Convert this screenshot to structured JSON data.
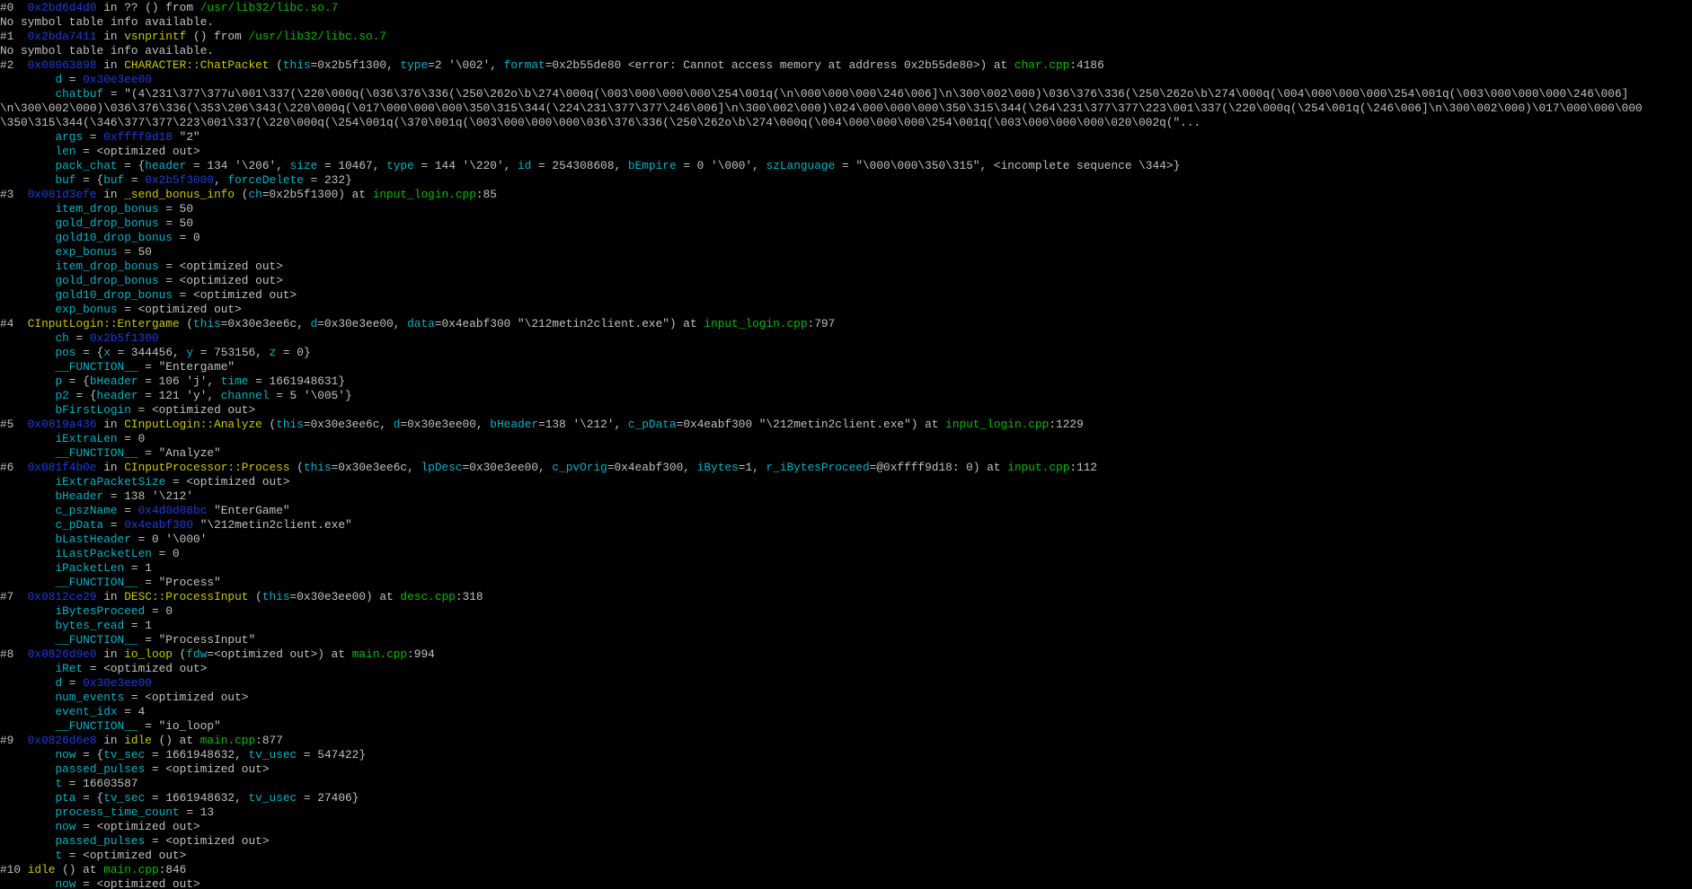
{
  "terminal": {
    "background_color": "#000000",
    "colors": {
      "text": "#c0c0c0",
      "address": "#1a3ce0",
      "function": "#c8c800",
      "variable": "#00b4c8",
      "file": "#00c000"
    },
    "lines": [
      [
        [
          "t",
          "#0  "
        ],
        [
          "addr",
          "0x2bd6d4d0"
        ],
        [
          "t",
          " in ?? () from "
        ],
        [
          "file",
          "/usr/lib32/libc.so.7"
        ]
      ],
      [
        [
          "t",
          "No symbol table info available."
        ]
      ],
      [
        [
          "t",
          "#1  "
        ],
        [
          "addr",
          "0x2bda7411"
        ],
        [
          "t",
          " in "
        ],
        [
          "fn",
          "vsnprintf"
        ],
        [
          "t",
          " () from "
        ],
        [
          "file",
          "/usr/lib32/libc.so.7"
        ]
      ],
      [
        [
          "t",
          "No symbol table info available."
        ]
      ],
      [
        [
          "t",
          "#2  "
        ],
        [
          "addr",
          "0x08063898"
        ],
        [
          "t",
          " in "
        ],
        [
          "fn",
          "CHARACTER::ChatPacket"
        ],
        [
          "t",
          " ("
        ],
        [
          "var",
          "this"
        ],
        [
          "t",
          "=0x2b5f1300, "
        ],
        [
          "var",
          "type"
        ],
        [
          "t",
          "=2 '\\002', "
        ],
        [
          "var",
          "format"
        ],
        [
          "t",
          "=0x2b55de80 <error: Cannot access memory at address 0x2b55de80>) at "
        ],
        [
          "file",
          "char.cpp"
        ],
        [
          "t",
          ":4186"
        ]
      ],
      [
        [
          "t",
          "        "
        ],
        [
          "var",
          "d"
        ],
        [
          "t",
          " = "
        ],
        [
          "addr",
          "0x30e3ee00"
        ]
      ],
      [
        [
          "t",
          "        "
        ],
        [
          "var",
          "chatbuf"
        ],
        [
          "t",
          " = \"(4\\231\\377\\377u\\001\\337(\\220\\000q(\\036\\376\\336(\\250\\262o\\b\\274\\000q(\\003\\000\\000\\000\\254\\001q(\\n\\000\\000\\000\\246\\006]\\n\\300\\002\\000)\\036\\376\\336(\\250\\262o\\b\\274\\000q(\\004\\000\\000\\000\\254\\001q(\\003\\000\\000\\000\\246\\006]"
        ]
      ],
      [
        [
          "t",
          "\\n\\300\\002\\000)\\036\\376\\336(\\353\\206\\343(\\220\\000q(\\017\\000\\000\\000\\350\\315\\344(\\224\\231\\377\\377\\246\\006]\\n\\300\\002\\000)\\024\\000\\000\\000\\350\\315\\344(\\264\\231\\377\\377\\223\\001\\337(\\220\\000q(\\254\\001q(\\246\\006]\\n\\300\\002\\000)\\017\\000\\000\\000"
        ]
      ],
      [
        [
          "t",
          "\\350\\315\\344(\\346\\377\\377\\223\\001\\337(\\220\\000q(\\254\\001q(\\370\\001q(\\003\\000\\000\\000\\036\\376\\336(\\250\\262o\\b\\274\\000q(\\004\\000\\000\\000\\254\\001q(\\003\\000\\000\\000\\020\\002q(\"..."
        ]
      ],
      [
        [
          "t",
          "        "
        ],
        [
          "var",
          "args"
        ],
        [
          "t",
          " = "
        ],
        [
          "addr",
          "0xffff9d18"
        ],
        [
          "t",
          " \"2\""
        ]
      ],
      [
        [
          "t",
          "        "
        ],
        [
          "var",
          "len"
        ],
        [
          "t",
          " = <optimized out>"
        ]
      ],
      [
        [
          "t",
          "        "
        ],
        [
          "var",
          "pack_chat"
        ],
        [
          "t",
          " = {"
        ],
        [
          "var",
          "header"
        ],
        [
          "t",
          " = 134 '\\206', "
        ],
        [
          "var",
          "size"
        ],
        [
          "t",
          " = 10467, "
        ],
        [
          "var",
          "type"
        ],
        [
          "t",
          " = 144 '\\220', "
        ],
        [
          "var",
          "id"
        ],
        [
          "t",
          " = 254308608, "
        ],
        [
          "var",
          "bEmpire"
        ],
        [
          "t",
          " = 0 '\\000', "
        ],
        [
          "var",
          "szLanguage"
        ],
        [
          "t",
          " = \"\\000\\000\\350\\315\", <incomplete sequence \\344>}"
        ]
      ],
      [
        [
          "t",
          "        "
        ],
        [
          "var",
          "buf"
        ],
        [
          "t",
          " = {"
        ],
        [
          "var",
          "buf"
        ],
        [
          "t",
          " = "
        ],
        [
          "addr",
          "0x2b5f3000"
        ],
        [
          "t",
          ", "
        ],
        [
          "var",
          "forceDelete"
        ],
        [
          "t",
          " = 232}"
        ]
      ],
      [
        [
          "t",
          "#3  "
        ],
        [
          "addr",
          "0x081d3efe"
        ],
        [
          "t",
          " in "
        ],
        [
          "fn",
          "_send_bonus_info"
        ],
        [
          "t",
          " ("
        ],
        [
          "var",
          "ch"
        ],
        [
          "t",
          "=0x2b5f1300) at "
        ],
        [
          "file",
          "input_login.cpp"
        ],
        [
          "t",
          ":85"
        ]
      ],
      [
        [
          "t",
          "        "
        ],
        [
          "var",
          "item_drop_bonus"
        ],
        [
          "t",
          " = 50"
        ]
      ],
      [
        [
          "t",
          "        "
        ],
        [
          "var",
          "gold_drop_bonus"
        ],
        [
          "t",
          " = 50"
        ]
      ],
      [
        [
          "t",
          "        "
        ],
        [
          "var",
          "gold10_drop_bonus"
        ],
        [
          "t",
          " = 0"
        ]
      ],
      [
        [
          "t",
          "        "
        ],
        [
          "var",
          "exp_bonus"
        ],
        [
          "t",
          " = 50"
        ]
      ],
      [
        [
          "t",
          "        "
        ],
        [
          "var",
          "item_drop_bonus"
        ],
        [
          "t",
          " = <optimized out>"
        ]
      ],
      [
        [
          "t",
          "        "
        ],
        [
          "var",
          "gold_drop_bonus"
        ],
        [
          "t",
          " = <optimized out>"
        ]
      ],
      [
        [
          "t",
          "        "
        ],
        [
          "var",
          "gold10_drop_bonus"
        ],
        [
          "t",
          " = <optimized out>"
        ]
      ],
      [
        [
          "t",
          "        "
        ],
        [
          "var",
          "exp_bonus"
        ],
        [
          "t",
          " = <optimized out>"
        ]
      ],
      [
        [
          "t",
          "#4  "
        ],
        [
          "fn",
          "CInputLogin::Entergame"
        ],
        [
          "t",
          " ("
        ],
        [
          "var",
          "this"
        ],
        [
          "t",
          "=0x30e3ee6c, "
        ],
        [
          "var",
          "d"
        ],
        [
          "t",
          "=0x30e3ee00, "
        ],
        [
          "var",
          "data"
        ],
        [
          "t",
          "=0x4eabf300 \"\\212metin2client.exe\") at "
        ],
        [
          "file",
          "input_login.cpp"
        ],
        [
          "t",
          ":797"
        ]
      ],
      [
        [
          "t",
          "        "
        ],
        [
          "var",
          "ch"
        ],
        [
          "t",
          " = "
        ],
        [
          "addr",
          "0x2b5f1300"
        ]
      ],
      [
        [
          "t",
          "        "
        ],
        [
          "var",
          "pos"
        ],
        [
          "t",
          " = {"
        ],
        [
          "var",
          "x"
        ],
        [
          "t",
          " = 344456, "
        ],
        [
          "var",
          "y"
        ],
        [
          "t",
          " = 753156, "
        ],
        [
          "var",
          "z"
        ],
        [
          "t",
          " = 0}"
        ]
      ],
      [
        [
          "t",
          "        "
        ],
        [
          "var",
          "__FUNCTION__"
        ],
        [
          "t",
          " = \"Entergame\""
        ]
      ],
      [
        [
          "t",
          "        "
        ],
        [
          "var",
          "p"
        ],
        [
          "t",
          " = {"
        ],
        [
          "var",
          "bHeader"
        ],
        [
          "t",
          " = 106 'j', "
        ],
        [
          "var",
          "time"
        ],
        [
          "t",
          " = 1661948631}"
        ]
      ],
      [
        [
          "t",
          "        "
        ],
        [
          "var",
          "p2"
        ],
        [
          "t",
          " = {"
        ],
        [
          "var",
          "header"
        ],
        [
          "t",
          " = 121 'y', "
        ],
        [
          "var",
          "channel"
        ],
        [
          "t",
          " = 5 '\\005'}"
        ]
      ],
      [
        [
          "t",
          "        "
        ],
        [
          "var",
          "bFirstLogin"
        ],
        [
          "t",
          " = <optimized out>"
        ]
      ],
      [
        [
          "t",
          "#5  "
        ],
        [
          "addr",
          "0x0819a436"
        ],
        [
          "t",
          " in "
        ],
        [
          "fn",
          "CInputLogin::Analyze"
        ],
        [
          "t",
          " ("
        ],
        [
          "var",
          "this"
        ],
        [
          "t",
          "=0x30e3ee6c, "
        ],
        [
          "var",
          "d"
        ],
        [
          "t",
          "=0x30e3ee00, "
        ],
        [
          "var",
          "bHeader"
        ],
        [
          "t",
          "=138 '\\212', "
        ],
        [
          "var",
          "c_pData"
        ],
        [
          "t",
          "=0x4eabf300 \"\\212metin2client.exe\") at "
        ],
        [
          "file",
          "input_login.cpp"
        ],
        [
          "t",
          ":1229"
        ]
      ],
      [
        [
          "t",
          "        "
        ],
        [
          "var",
          "iExtraLen"
        ],
        [
          "t",
          " = 0"
        ]
      ],
      [
        [
          "t",
          "        "
        ],
        [
          "var",
          "__FUNCTION__"
        ],
        [
          "t",
          " = \"Analyze\""
        ]
      ],
      [
        [
          "t",
          "#6  "
        ],
        [
          "addr",
          "0x081f4b0e"
        ],
        [
          "t",
          " in "
        ],
        [
          "fn",
          "CInputProcessor::Process"
        ],
        [
          "t",
          " ("
        ],
        [
          "var",
          "this"
        ],
        [
          "t",
          "=0x30e3ee6c, "
        ],
        [
          "var",
          "lpDesc"
        ],
        [
          "t",
          "=0x30e3ee00, "
        ],
        [
          "var",
          "c_pvOrig"
        ],
        [
          "t",
          "=0x4eabf300, "
        ],
        [
          "var",
          "iBytes"
        ],
        [
          "t",
          "=1, "
        ],
        [
          "var",
          "r_iBytesProceed"
        ],
        [
          "t",
          "=@0xffff9d18: 0) at "
        ],
        [
          "file",
          "input.cpp"
        ],
        [
          "t",
          ":112"
        ]
      ],
      [
        [
          "t",
          "        "
        ],
        [
          "var",
          "iExtraPacketSize"
        ],
        [
          "t",
          " = <optimized out>"
        ]
      ],
      [
        [
          "t",
          "        "
        ],
        [
          "var",
          "bHeader"
        ],
        [
          "t",
          " = 138 '\\212'"
        ]
      ],
      [
        [
          "t",
          "        "
        ],
        [
          "var",
          "c_pszName"
        ],
        [
          "t",
          " = "
        ],
        [
          "addr",
          "0x4d0d08bc"
        ],
        [
          "t",
          " \"EnterGame\""
        ]
      ],
      [
        [
          "t",
          "        "
        ],
        [
          "var",
          "c_pData"
        ],
        [
          "t",
          " = "
        ],
        [
          "addr",
          "0x4eabf300"
        ],
        [
          "t",
          " \"\\212metin2client.exe\""
        ]
      ],
      [
        [
          "t",
          "        "
        ],
        [
          "var",
          "bLastHeader"
        ],
        [
          "t",
          " = 0 '\\000'"
        ]
      ],
      [
        [
          "t",
          "        "
        ],
        [
          "var",
          "iLastPacketLen"
        ],
        [
          "t",
          " = 0"
        ]
      ],
      [
        [
          "t",
          "        "
        ],
        [
          "var",
          "iPacketLen"
        ],
        [
          "t",
          " = 1"
        ]
      ],
      [
        [
          "t",
          "        "
        ],
        [
          "var",
          "__FUNCTION__"
        ],
        [
          "t",
          " = \"Process\""
        ]
      ],
      [
        [
          "t",
          "#7  "
        ],
        [
          "addr",
          "0x0812ce29"
        ],
        [
          "t",
          " in "
        ],
        [
          "fn",
          "DESC::ProcessInput"
        ],
        [
          "t",
          " ("
        ],
        [
          "var",
          "this"
        ],
        [
          "t",
          "=0x30e3ee00) at "
        ],
        [
          "file",
          "desc.cpp"
        ],
        [
          "t",
          ":318"
        ]
      ],
      [
        [
          "t",
          "        "
        ],
        [
          "var",
          "iBytesProceed"
        ],
        [
          "t",
          " = 0"
        ]
      ],
      [
        [
          "t",
          "        "
        ],
        [
          "var",
          "bytes_read"
        ],
        [
          "t",
          " = 1"
        ]
      ],
      [
        [
          "t",
          "        "
        ],
        [
          "var",
          "__FUNCTION__"
        ],
        [
          "t",
          " = \"ProcessInput\""
        ]
      ],
      [
        [
          "t",
          "#8  "
        ],
        [
          "addr",
          "0x0826d9e0"
        ],
        [
          "t",
          " in "
        ],
        [
          "fn",
          "io_loop"
        ],
        [
          "t",
          " ("
        ],
        [
          "var",
          "fdw"
        ],
        [
          "t",
          "=<optimized out>) at "
        ],
        [
          "file",
          "main.cpp"
        ],
        [
          "t",
          ":994"
        ]
      ],
      [
        [
          "t",
          "        "
        ],
        [
          "var",
          "iRet"
        ],
        [
          "t",
          " = <optimized out>"
        ]
      ],
      [
        [
          "t",
          "        "
        ],
        [
          "var",
          "d"
        ],
        [
          "t",
          " = "
        ],
        [
          "addr",
          "0x30e3ee00"
        ]
      ],
      [
        [
          "t",
          "        "
        ],
        [
          "var",
          "num_events"
        ],
        [
          "t",
          " = <optimized out>"
        ]
      ],
      [
        [
          "t",
          "        "
        ],
        [
          "var",
          "event_idx"
        ],
        [
          "t",
          " = 4"
        ]
      ],
      [
        [
          "t",
          "        "
        ],
        [
          "var",
          "__FUNCTION__"
        ],
        [
          "t",
          " = \"io_loop\""
        ]
      ],
      [
        [
          "t",
          "#9  "
        ],
        [
          "addr",
          "0x0826d6e8"
        ],
        [
          "t",
          " in "
        ],
        [
          "fn",
          "idle"
        ],
        [
          "t",
          " () at "
        ],
        [
          "file",
          "main.cpp"
        ],
        [
          "t",
          ":877"
        ]
      ],
      [
        [
          "t",
          "        "
        ],
        [
          "var",
          "now"
        ],
        [
          "t",
          " = {"
        ],
        [
          "var",
          "tv_sec"
        ],
        [
          "t",
          " = 1661948632, "
        ],
        [
          "var",
          "tv_usec"
        ],
        [
          "t",
          " = 547422}"
        ]
      ],
      [
        [
          "t",
          "        "
        ],
        [
          "var",
          "passed_pulses"
        ],
        [
          "t",
          " = <optimized out>"
        ]
      ],
      [
        [
          "t",
          "        "
        ],
        [
          "var",
          "t"
        ],
        [
          "t",
          " = 16603587"
        ]
      ],
      [
        [
          "t",
          "        "
        ],
        [
          "var",
          "pta"
        ],
        [
          "t",
          " = {"
        ],
        [
          "var",
          "tv_sec"
        ],
        [
          "t",
          " = 1661948632, "
        ],
        [
          "var",
          "tv_usec"
        ],
        [
          "t",
          " = 27406}"
        ]
      ],
      [
        [
          "t",
          "        "
        ],
        [
          "var",
          "process_time_count"
        ],
        [
          "t",
          " = 13"
        ]
      ],
      [
        [
          "t",
          "        "
        ],
        [
          "var",
          "now"
        ],
        [
          "t",
          " = <optimized out>"
        ]
      ],
      [
        [
          "t",
          "        "
        ],
        [
          "var",
          "passed_pulses"
        ],
        [
          "t",
          " = <optimized out>"
        ]
      ],
      [
        [
          "t",
          "        "
        ],
        [
          "var",
          "t"
        ],
        [
          "t",
          " = <optimized out>"
        ]
      ],
      [
        [
          "t",
          "#10 "
        ],
        [
          "fn",
          "idle"
        ],
        [
          "t",
          " () at "
        ],
        [
          "file",
          "main.cpp"
        ],
        [
          "t",
          ":846"
        ]
      ],
      [
        [
          "t",
          "        "
        ],
        [
          "var",
          "now"
        ],
        [
          "t",
          " = <optimized out>"
        ]
      ]
    ]
  }
}
